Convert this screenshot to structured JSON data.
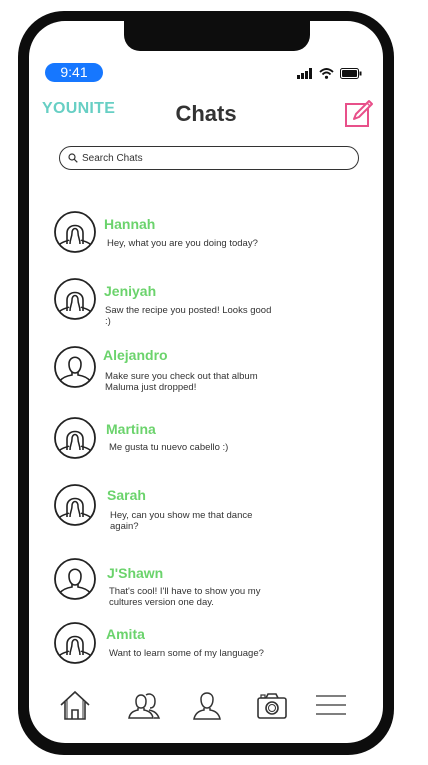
{
  "status_bar": {
    "time": "9:41"
  },
  "header": {
    "brand": "YOUNITE",
    "title": "Chats"
  },
  "search": {
    "placeholder": "Search Chats"
  },
  "chats": [
    {
      "name": "Hannah",
      "message": "Hey, what you are you doing today?"
    },
    {
      "name": "Jeniyah",
      "message": "Saw the recipe you posted! Looks good :)"
    },
    {
      "name": "Alejandro",
      "message": "Make sure you check out that album Maluma just dropped!"
    },
    {
      "name": "Martina",
      "message": "Me gusta tu nuevo cabello :)"
    },
    {
      "name": "Sarah",
      "message": "Hey, can you show me that dance again?"
    },
    {
      "name": "J'Shawn",
      "message": "That's cool! I'll have to show you my cultures version one day."
    },
    {
      "name": "Amita",
      "message": "Want to learn some of my language?"
    }
  ],
  "tab_bar": {
    "items": [
      "home-icon",
      "friends-icon",
      "profile-icon",
      "camera-icon",
      "menu-icon"
    ]
  },
  "colors": {
    "brand": "#67cfc4",
    "names": "#6bd36c",
    "time_pill": "#1677ff",
    "compose": "#e8508a"
  }
}
